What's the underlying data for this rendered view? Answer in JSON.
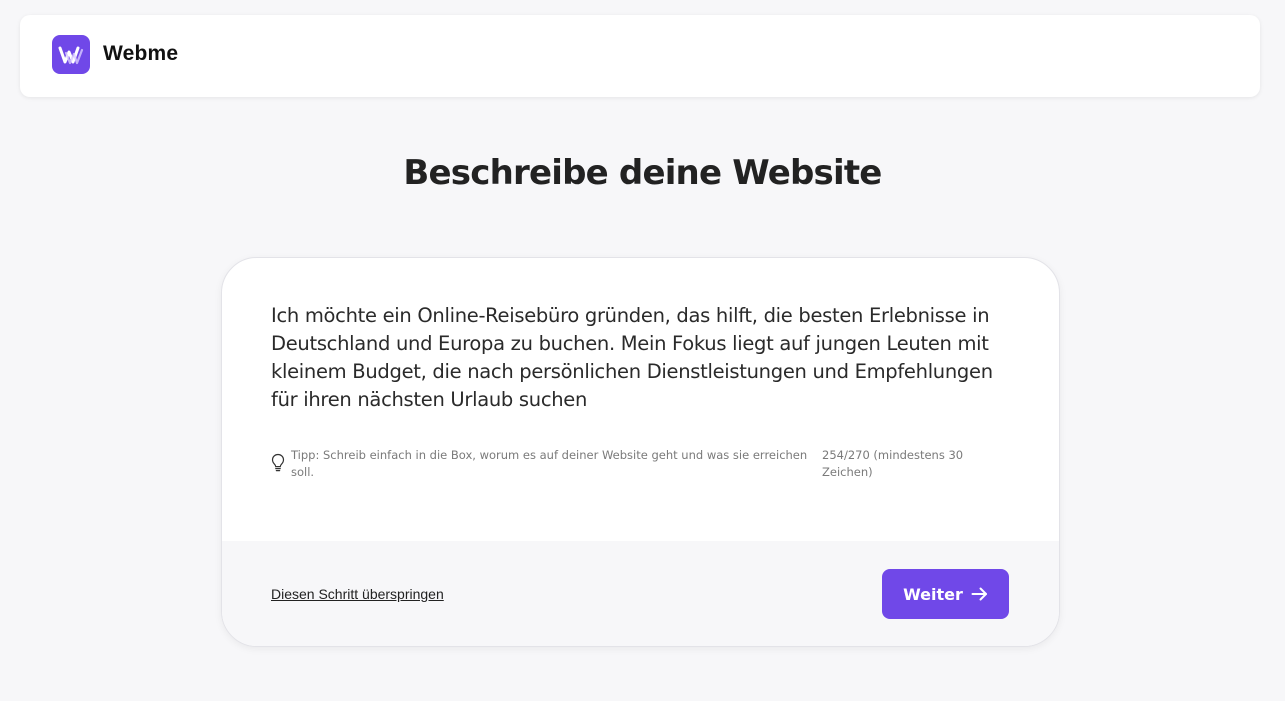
{
  "header": {
    "brand_name": "Webme",
    "logo_color": "#7048e8"
  },
  "main": {
    "page_title": "Beschreibe deine Website",
    "description": "Ich möchte ein Online-Reisebüro gründen, das hilft, die besten Erlebnisse in Deutschland und Europa zu buchen. Mein Fokus liegt auf jungen Leuten mit kleinem Budget, die nach persönlichen Dienstleistungen und Empfehlungen für ihren nächsten Urlaub suchen",
    "tip_icon": "lightbulb-icon",
    "tip": "Tipp: Schreib einfach in die Box, worum es auf deiner Website geht und was sie erreichen soll.",
    "char_count": "254/270 (mindestens 30 Zeichen)"
  },
  "footer": {
    "skip_label": "Diesen Schritt überspringen",
    "next_label": "Weiter",
    "next_icon": "arrow-right-icon",
    "accent_color": "#7048e8"
  }
}
